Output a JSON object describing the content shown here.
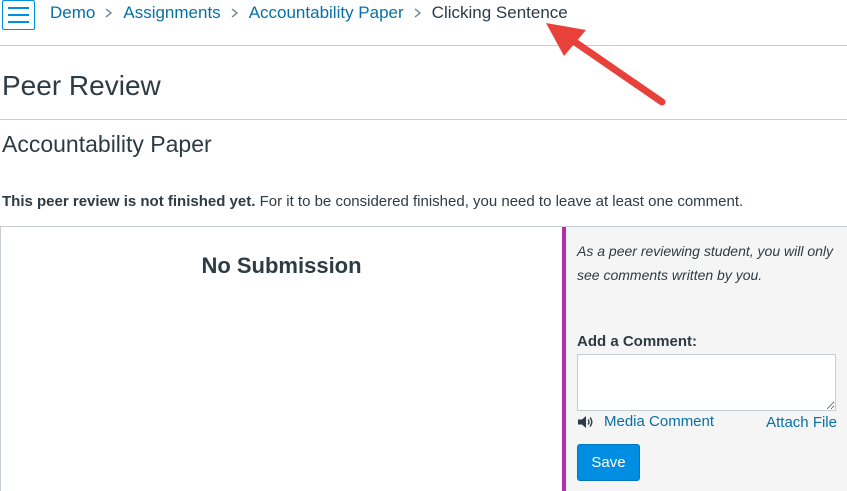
{
  "breadcrumb": {
    "items": [
      "Demo",
      "Assignments",
      "Accountability Paper"
    ],
    "current": "Clicking Sentence"
  },
  "page": {
    "title": "Peer Review",
    "subtitle": "Accountability Paper",
    "status_bold": "This peer review is not finished yet.",
    "status_rest": " For it to be considered finished, you need to leave at least one comment."
  },
  "submission": {
    "empty_label": "No Submission"
  },
  "comments": {
    "note": "As a peer reviewing student, you will only see comments written by you.",
    "add_label": "Add a Comment:",
    "input_value": "",
    "media_label": "Media Comment",
    "attach_label": "Attach File",
    "save_label": "Save"
  },
  "colors": {
    "link": "#0770a3",
    "accent": "#008ee2",
    "side_border": "#b12fac",
    "arrow": "#e8403a"
  },
  "icons": [
    "hamburger-menu-icon",
    "chevron-right-icon",
    "speaker-icon",
    "annotation-arrow"
  ]
}
